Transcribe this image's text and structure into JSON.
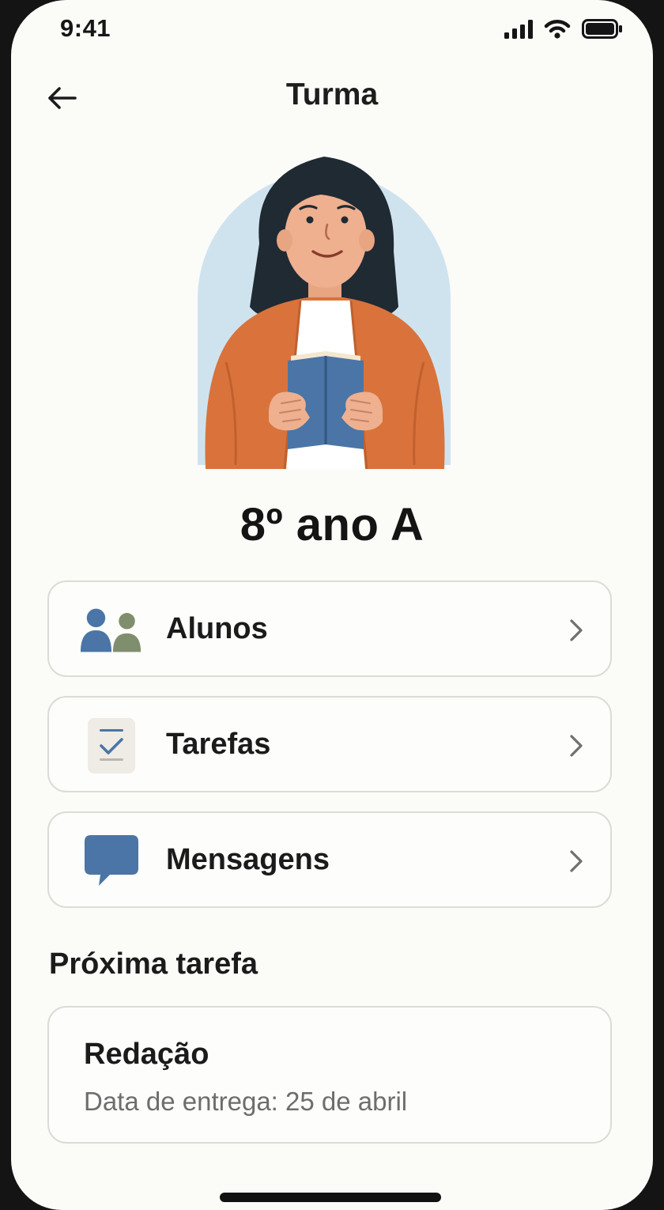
{
  "status_bar": {
    "time": "9:41",
    "icons": [
      "signal-icon",
      "wifi-icon",
      "battery-icon"
    ]
  },
  "header": {
    "title": "Turma",
    "back_icon": "arrow-left-icon"
  },
  "hero": {
    "illustration": "teacher-reading-book-illustration"
  },
  "class": {
    "name": "8º ano A"
  },
  "menu": [
    {
      "label": "Alunos",
      "icon": "students-icon"
    },
    {
      "label": "Tarefas",
      "icon": "tasks-checklist-icon"
    },
    {
      "label": "Mensagens",
      "icon": "message-bubble-icon"
    }
  ],
  "next_task": {
    "section_title": "Próxima tarefa",
    "title": "Redação",
    "due": "Data de entrega: 25 de abril"
  },
  "colors": {
    "background": "#fbfbf8",
    "accent_blue": "#4a75a6",
    "accent_green": "#7f8f6d",
    "cardigan_orange": "#d9733b"
  }
}
